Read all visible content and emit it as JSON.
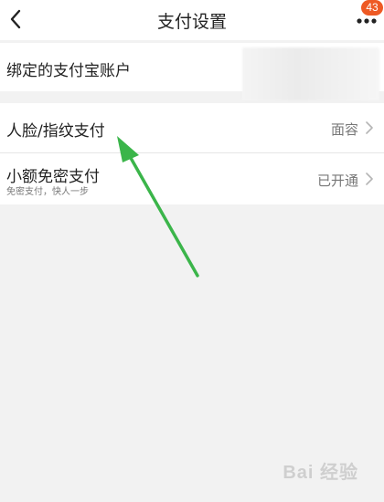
{
  "header": {
    "title": "支付设置",
    "badge_count": "43",
    "back_icon": "chevron-left-icon",
    "more_icon": "more-dots-icon"
  },
  "rows": [
    {
      "label": "绑定的支付宝账户",
      "value": ""
    },
    {
      "label": "人脸/指纹支付",
      "value": "面容"
    },
    {
      "label": "小额免密支付",
      "sub": "免密支付，快人一步",
      "value": "已开通"
    }
  ],
  "colors": {
    "badge": "#ee5a24",
    "arrow": "#3bb54a"
  },
  "watermark": {
    "text": "Bai 经验"
  }
}
